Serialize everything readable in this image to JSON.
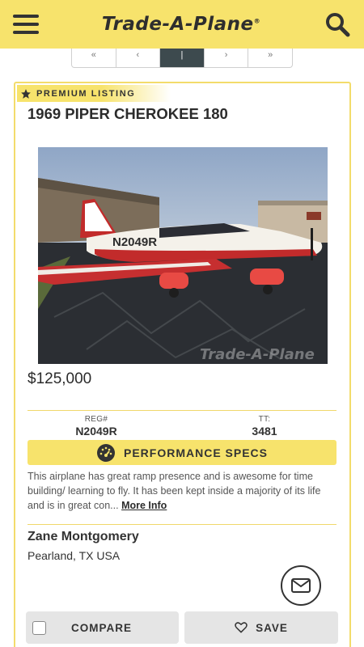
{
  "header": {
    "logo_text": "Trade-A-Plane",
    "logo_mark": "®",
    "menu_icon": "hamburger-menu-icon",
    "search_icon": "search-icon"
  },
  "listing": {
    "badge": "PREMIUM LISTING",
    "badge_icon": "star-icon",
    "title": "1969 PIPER CHEROKEE 180",
    "image_tail_number": "N2049R",
    "watermark": "Trade-A-Plane",
    "price": "$125,000",
    "reg_label": "REG#",
    "reg_value": "N2049R",
    "tt_label": "TT:",
    "tt_value": "3481",
    "performance_button": "PERFORMANCE SPECS",
    "performance_icon": "speedometer-icon",
    "description": "This airplane has great ramp presence and is awesome for time building/ learning to fly. It has been kept inside a majority of its life and is in great con...",
    "more_info": "More Info",
    "seller_name": "Zane Montgomery",
    "seller_location": "Pearland, TX USA",
    "email_icon": "envelope-icon"
  },
  "actions": {
    "compare_label": "COMPARE",
    "save_label": "SAVE",
    "save_icon": "heart-icon"
  },
  "colors": {
    "brand_yellow": "#f7e36c",
    "dark": "#333333",
    "pager_active": "#3d4a4e"
  }
}
